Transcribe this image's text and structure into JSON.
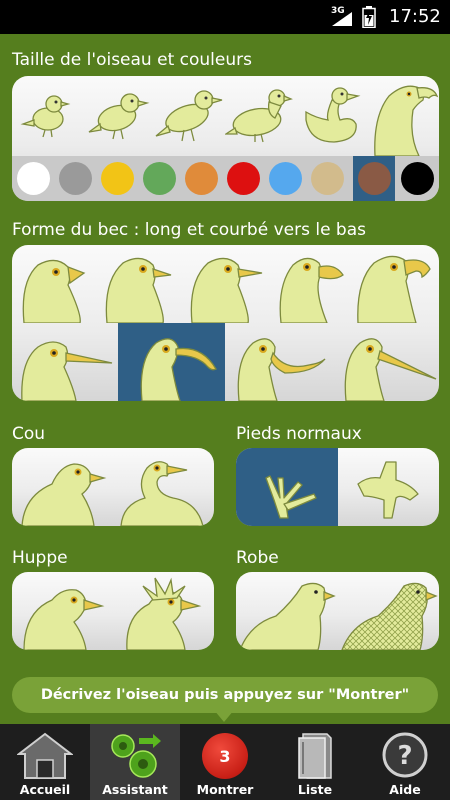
{
  "status_bar": {
    "network": "3G",
    "time": "17:52"
  },
  "sections": {
    "size_colors": {
      "title": "Taille de l'oiseau et couleurs"
    },
    "beak": {
      "title": "Forme du bec : long et courbé vers le bas"
    },
    "neck": {
      "title": "Cou"
    },
    "feet": {
      "title": "Pieds normaux"
    },
    "crest": {
      "title": "Huppe"
    },
    "plumage": {
      "title": "Robe"
    }
  },
  "sizes": [
    "tiny-bird",
    "small-bird",
    "medium-bird",
    "pigeon-size",
    "duck-size",
    "large-bird"
  ],
  "colors": [
    {
      "name": "white",
      "hex": "#ffffff"
    },
    {
      "name": "grey",
      "hex": "#9a9a9a"
    },
    {
      "name": "yellow",
      "hex": "#f2c416"
    },
    {
      "name": "green",
      "hex": "#63a85a"
    },
    {
      "name": "orange",
      "hex": "#e08b3a"
    },
    {
      "name": "red",
      "hex": "#dd1010"
    },
    {
      "name": "blue",
      "hex": "#55a8ee"
    },
    {
      "name": "beige",
      "hex": "#d2bb8c"
    },
    {
      "name": "brown",
      "hex": "#8a5a45",
      "selected": true
    },
    {
      "name": "black",
      "hex": "#000000"
    }
  ],
  "beaks_row1": [
    "short-conical",
    "thin",
    "pointed",
    "duck-bill",
    "hooked"
  ],
  "beaks_row2": [
    "long-straight",
    "long-downcurved",
    "long-upcurved",
    "very-long-straight"
  ],
  "selected_beak": "long-downcurved",
  "selected_feet": "normal",
  "hint": "Décrivez l'oiseau puis appuyez sur \"Montrer\"",
  "nav": {
    "home": "Accueil",
    "assistant": "Assistant",
    "show": "Montrer",
    "show_count": "3",
    "list": "Liste",
    "help": "Aide"
  },
  "theme": {
    "background": "#557e1e",
    "selected": "#2f5f86",
    "bird_fill": "#e3eb9c"
  }
}
